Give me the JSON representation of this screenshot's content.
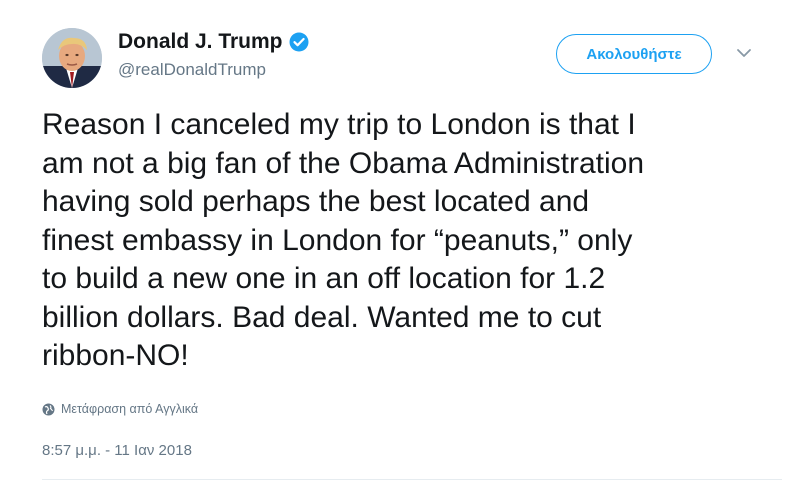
{
  "user": {
    "display_name": "Donald J. Trump",
    "handle": "@realDonaldTrump",
    "verified": true
  },
  "actions": {
    "follow_label": "Ακολουθήστε",
    "menu_icon": "chevron-down-icon"
  },
  "tweet": {
    "text": "Reason I canceled my trip to London is that I\nam not a big fan of the Obama Administration\nhaving sold perhaps the best located and\nfinest embassy in London for “peanuts,” only\nto build a new one in an off location for 1.2\nbillion dollars. Bad deal. Wanted me to cut\nribbon-NO!",
    "translate_label": "Μετάφραση από Αγγλικά",
    "timestamp": "8:57 μ.μ. - 11 Ιαν 2018"
  },
  "colors": {
    "accent": "#1da1f2",
    "text": "#14171a",
    "muted": "#657786",
    "divider": "#e6ecf0"
  },
  "icons": {
    "verified": "verified-badge-icon",
    "translate": "globe-icon",
    "avatar": "avatar"
  }
}
